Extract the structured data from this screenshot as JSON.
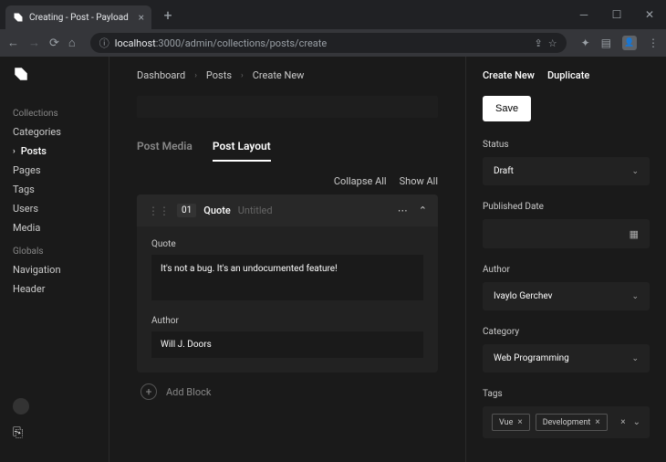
{
  "browser": {
    "tab_title": "Creating - Post - Payload",
    "url_host": "localhost",
    "url_port": ":3000",
    "url_path": "/admin/collections/posts/create"
  },
  "sidebar": {
    "collections_header": "Collections",
    "collections": [
      {
        "label": "Categories",
        "active": false
      },
      {
        "label": "Posts",
        "active": true
      },
      {
        "label": "Pages",
        "active": false
      },
      {
        "label": "Tags",
        "active": false
      },
      {
        "label": "Users",
        "active": false
      },
      {
        "label": "Media",
        "active": false
      }
    ],
    "globals_header": "Globals",
    "globals": [
      {
        "label": "Navigation"
      },
      {
        "label": "Header"
      }
    ]
  },
  "breadcrumb": {
    "items": [
      "Dashboard",
      "Posts",
      "Create New"
    ]
  },
  "tabs": {
    "media": "Post Media",
    "layout": "Post Layout"
  },
  "actions": {
    "collapse": "Collapse All",
    "show": "Show All"
  },
  "block": {
    "number": "01",
    "type": "Quote",
    "untitled": "Untitled",
    "quote_label": "Quote",
    "quote_value": "It's not a bug. It's an undocumented feature!",
    "author_label": "Author",
    "author_value": "Will J. Doors"
  },
  "add_block_label": "Add Block",
  "rightbar": {
    "create_new": "Create New",
    "duplicate": "Duplicate",
    "save": "Save",
    "status_label": "Status",
    "status_value": "Draft",
    "published_label": "Published Date",
    "author_label": "Author",
    "author_value": "Ivaylo Gerchev",
    "category_label": "Category",
    "category_value": "Web Programming",
    "tags_label": "Tags",
    "tags": [
      "Vue",
      "Development"
    ]
  }
}
